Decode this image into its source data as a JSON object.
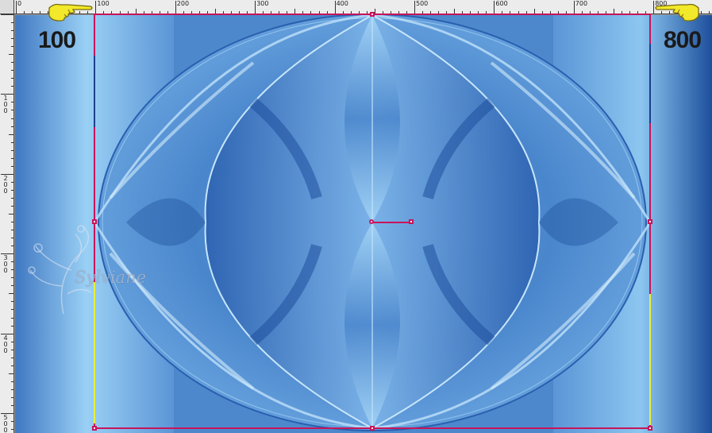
{
  "ruler": {
    "top_labels": [
      "0",
      "100",
      "200",
      "300",
      "400",
      "500",
      "600",
      "700",
      "800"
    ],
    "left_labels": [
      "1\n0\n0",
      "2\n0\n0",
      "3\n0\n0",
      "4\n0\n0",
      "5\n0\n0"
    ]
  },
  "markers": {
    "left_value": "100",
    "right_value": "800",
    "left_pointer_icon": "pointing-hand-icon",
    "right_pointer_icon": "pointing-hand-icon"
  },
  "watermark": {
    "text": "Sylviane"
  },
  "colors": {
    "canvas_light": "#8ec8f2",
    "canvas_mid": "#4a86cc",
    "canvas_dark": "#1d4f9c",
    "selection": "#c8145a",
    "guide_yellow": "#e6f03a",
    "pointer_yellow": "#f2e92a"
  }
}
